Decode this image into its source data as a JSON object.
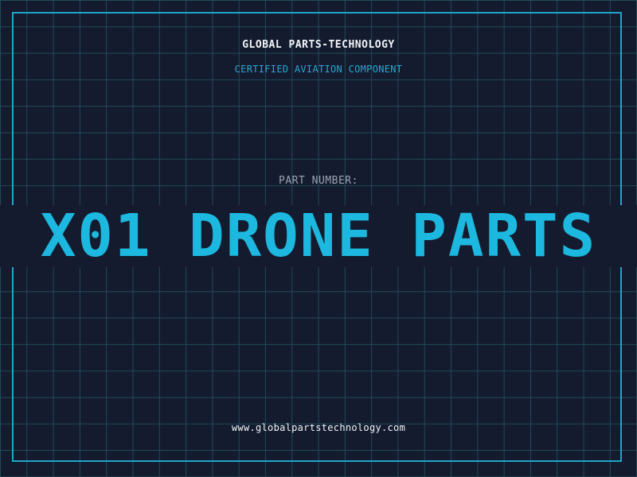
{
  "header": {
    "company": "GLOBAL PARTS-TECHNOLOGY",
    "tagline": "CERTIFIED AVIATION COMPONENT"
  },
  "part": {
    "label": "PART NUMBER:",
    "number": "X01 DRONE PARTS"
  },
  "footer": {
    "url": "www.globalpartstechnology.com"
  },
  "colors": {
    "background": "#141b2e",
    "grid": "#1f4a5a",
    "frame": "#1fa6c8",
    "accent": "#1db8df",
    "label": "#9aa3b2",
    "text": "#f2f4f7"
  }
}
